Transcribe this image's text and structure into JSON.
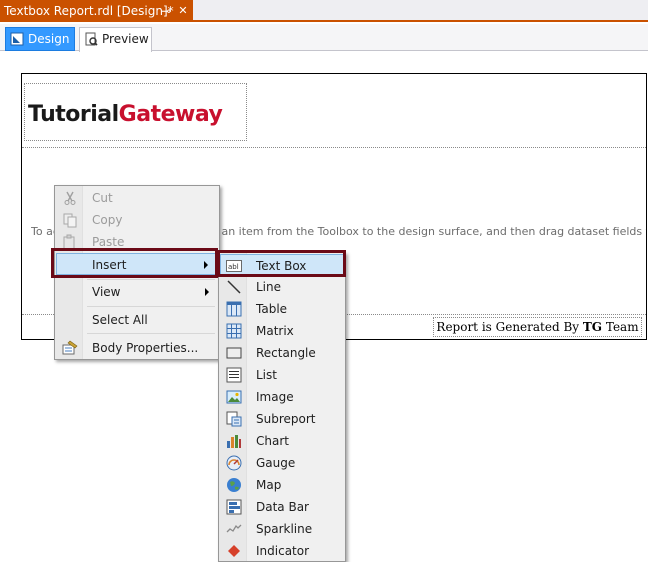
{
  "document_tab": {
    "title": "Textbox Report.rdl [Design]*",
    "pin_glyph": "⊸",
    "close_glyph": "✕"
  },
  "view_tabs": [
    {
      "label": "Design",
      "active": true,
      "icon": "design-icon"
    },
    {
      "label": "Preview",
      "active": false,
      "icon": "preview-icon"
    }
  ],
  "report": {
    "logo": {
      "word1": "Tutorial",
      "word2": "Gateway"
    },
    "body_hint": "To add an item to the report: drag an item from the Toolbox to the design surface, and then drag dataset fields to the item.",
    "footer_prefix": "Report is Generated By ",
    "footer_bold": "TG",
    "footer_suffix": " Team"
  },
  "context_menu": {
    "items": [
      {
        "label": "Cut",
        "enabled": false,
        "icon": "cut-icon"
      },
      {
        "label": "Copy",
        "enabled": false,
        "icon": "copy-icon"
      },
      {
        "label": "Paste",
        "enabled": false,
        "icon": "paste-icon"
      },
      {
        "label": "Insert",
        "enabled": true,
        "submenu": true,
        "highlighted": true
      },
      {
        "label": "View",
        "enabled": true,
        "submenu": true
      },
      {
        "label": "Select All",
        "enabled": true
      },
      {
        "label": "Body Properties...",
        "enabled": true,
        "icon": "properties-icon"
      }
    ]
  },
  "insert_menu": {
    "items": [
      {
        "label": "Text Box",
        "icon": "textbox-icon",
        "highlighted": true
      },
      {
        "label": "Line",
        "icon": "line-icon"
      },
      {
        "label": "Table",
        "icon": "table-icon"
      },
      {
        "label": "Matrix",
        "icon": "matrix-icon"
      },
      {
        "label": "Rectangle",
        "icon": "rectangle-icon"
      },
      {
        "label": "List",
        "icon": "list-icon"
      },
      {
        "label": "Image",
        "icon": "image-icon"
      },
      {
        "label": "Subreport",
        "icon": "subreport-icon"
      },
      {
        "label": "Chart",
        "icon": "chart-icon"
      },
      {
        "label": "Gauge",
        "icon": "gauge-icon"
      },
      {
        "label": "Map",
        "icon": "map-icon"
      },
      {
        "label": "Data Bar",
        "icon": "databar-icon"
      },
      {
        "label": "Sparkline",
        "icon": "sparkline-icon"
      },
      {
        "label": "Indicator",
        "icon": "indicator-icon"
      }
    ]
  },
  "colors": {
    "doc_tab": "#ca5100",
    "design_tab": "#3399ff",
    "highlight_frame": "#6b0a17",
    "logo_red": "#c8102e"
  }
}
